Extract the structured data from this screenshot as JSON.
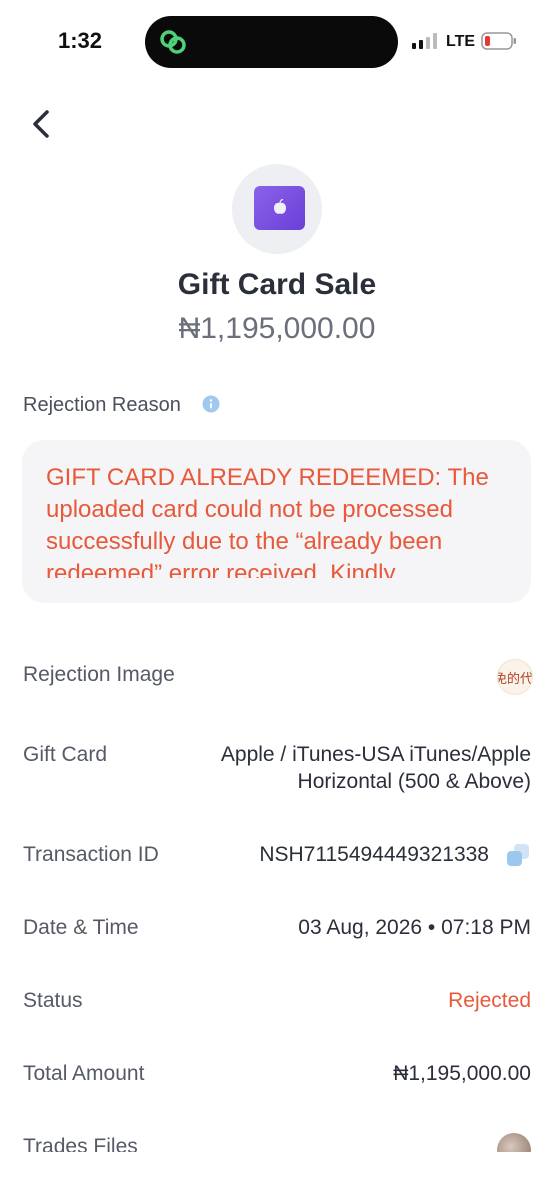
{
  "status_bar": {
    "time": "1:32",
    "network": "LTE",
    "icons": [
      "signal-icon",
      "battery-low-icon",
      "app-logo-icon"
    ]
  },
  "header": {
    "back_icon": "chevron-left-icon"
  },
  "summary": {
    "card_icon": "apple-gift-card-icon",
    "title": "Gift Card Sale",
    "amount": "₦1,195,000.00"
  },
  "rejection": {
    "label": "Rejection Reason",
    "info_icon": "info-icon",
    "text": "GIFT CARD ALREADY REDEEMED: The uploaded card could not be processed successfully due to the “already been redeemed” error received. Kindly"
  },
  "details": {
    "rejection_image_label": "Rejection Image",
    "rejection_image_thumb_text": "免的代码",
    "gift_card_label": "Gift Card",
    "gift_card_value_line1": "Apple / iTunes-USA iTunes/Apple",
    "gift_card_value_line2": "Horizontal (500 & Above)",
    "transaction_id_label": "Transaction ID",
    "transaction_id_value": "NSH7115494449321338",
    "date_time_label": "Date & Time",
    "date_time_value": "03 Aug, 2026 • 07:18 PM",
    "status_label": "Status",
    "status_value": "Rejected",
    "total_amount_label": "Total Amount",
    "total_amount_value": "₦1,195,000.00",
    "trades_files_label": "Trades Files"
  },
  "colors": {
    "rejected": "#e8593b",
    "card_purple": "#7b52e0",
    "text_dark": "#2b2f3a"
  }
}
